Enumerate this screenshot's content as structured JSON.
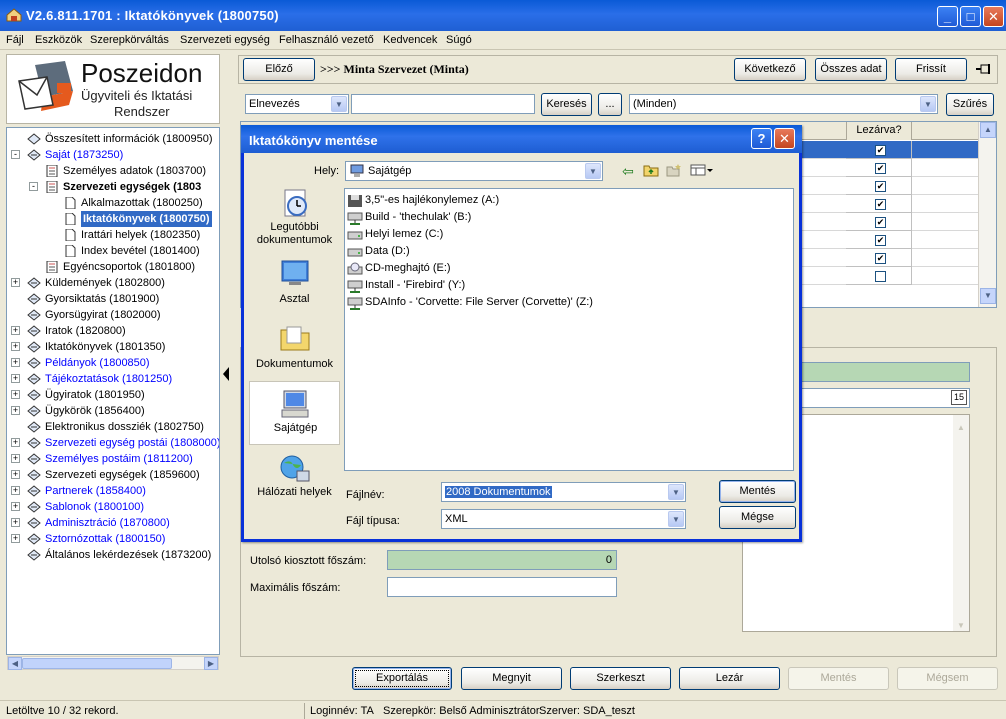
{
  "window": {
    "title": "V2.6.811.1701 : Iktatókönyvek (1800750)"
  },
  "menu": [
    "Fájl",
    "Eszközök",
    "Szerepkörváltás",
    "Szervezeti egység",
    "Felhasználó vezető",
    "Kedvencek",
    "Súgó"
  ],
  "logo": {
    "line1": "Poszeidon",
    "line2": "Ügyviteli és Iktatási",
    "line3": "Rendszer"
  },
  "tree": [
    {
      "label": "Összesített információk (1800950)"
    },
    {
      "label": "Saját (1873250)"
    },
    {
      "label": "Személyes adatok (1803700)"
    },
    {
      "label": "Szervezeti egységek (1803"
    },
    {
      "label": "Alkalmazottak (1800250)"
    },
    {
      "label": "Iktatókönyvek (1800750)"
    },
    {
      "label": "Irattári helyek (1802350)"
    },
    {
      "label": "Index bevétel (1801400)"
    },
    {
      "label": "Egyéncsoportok (1801800)"
    },
    {
      "label": "Küldemények (1802800)"
    },
    {
      "label": "Gyorsiktatás (1801900)"
    },
    {
      "label": "Gyorsügyirat (1802000)"
    },
    {
      "label": "Iratok (1820800)"
    },
    {
      "label": "Iktatókönyvek (1801350)"
    },
    {
      "label": "Példányok (1800850)"
    },
    {
      "label": "Tájékoztatások (1801250)"
    },
    {
      "label": "Ügyiratok (1801950)"
    },
    {
      "label": "Ügykörök (1856400)"
    },
    {
      "label": "Elektronikus dossziék (1802750)"
    },
    {
      "label": "Szervezeti egység postái (1808000)"
    },
    {
      "label": "Személyes postáim (1811200)"
    },
    {
      "label": "Szervezeti egységek (1859600)"
    },
    {
      "label": "Partnerek (1858400)"
    },
    {
      "label": "Sablonok (1800100)"
    },
    {
      "label": "Adminisztráció (1870800)"
    },
    {
      "label": "Sztornózottak (1800150)"
    },
    {
      "label": "Általános lekérdezések (1873200)"
    }
  ],
  "nav": {
    "prev": "Előző",
    "breadcrumb": ">>> Minta Szervezet (Minta)",
    "next": "Következő",
    "all_data": "Összes adat",
    "refresh": "Frissít"
  },
  "filter": {
    "field": "Elnevezés",
    "search": "Keresés",
    "ellipsis": "...",
    "scope": "(Minden)",
    "filter_btn": "Szűrés"
  },
  "grid": {
    "col_closed": "Lezárva?",
    "rows": [
      true,
      true,
      true,
      true,
      true,
      true,
      true,
      false
    ]
  },
  "detail": {
    "last_number_label": "Utolsó kiosztott főszám:",
    "last_number_value": "0",
    "max_number_label": "Maximális főszám:",
    "date_icon": "15"
  },
  "bottom_buttons": {
    "export": "Exportálás",
    "open": "Megnyit",
    "edit": "Szerkeszt",
    "close": "Lezár",
    "save": "Mentés",
    "cancel": "Mégsem"
  },
  "status": {
    "loaded": "Letöltve 10 / 32 rekord.",
    "login": "Loginnév: TA",
    "role": "Szerepkör: Belső Adminisztrátor",
    "server": "Szerver: SDA_teszt"
  },
  "dialog": {
    "title": "Iktatókönyv mentése",
    "location_label": "Hely:",
    "location_value": "Sajátgép",
    "places": [
      "Legutóbbi dokumentumok",
      "Asztal",
      "Dokumentumok",
      "Sajátgép",
      "Hálózati helyek"
    ],
    "items": [
      "3,5\"-es hajlékonylemez (A:)",
      "Build - 'thechulak' (B:)",
      "Helyi lemez (C:)",
      "Data (D:)",
      "CD-meghajtó (E:)",
      "Install - 'Firebird' (Y:)",
      "SDAInfo - 'Corvette: File Server (Corvette)' (Z:)"
    ],
    "filename_label": "Fájlnév:",
    "filename_value": "2008 Dokumentumok",
    "filetype_label": "Fájl típusa:",
    "filetype_value": "XML",
    "save": "Mentés",
    "cancel": "Mégse",
    "help": "?",
    "close": "✕"
  }
}
